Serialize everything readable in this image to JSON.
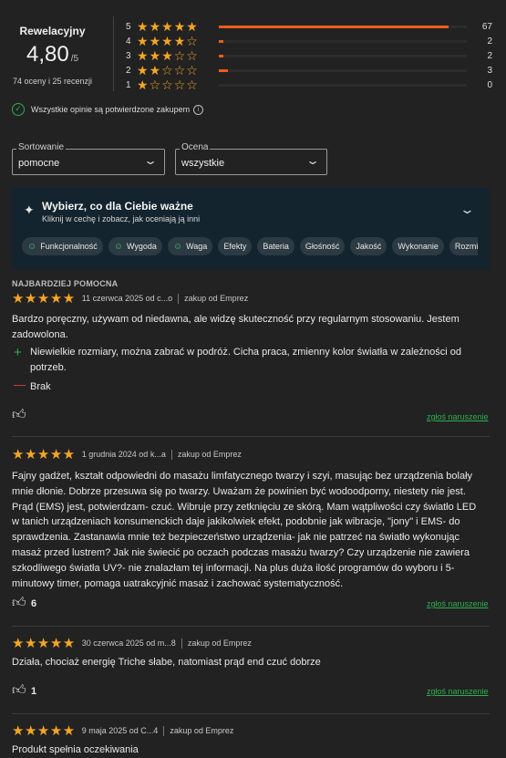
{
  "summary": {
    "label": "Rewelacyjny",
    "rating": "4,80",
    "rating_of": "/5",
    "counts_text": "74 oceny i 25 recenzji",
    "verified_text": "Wszystkie opinie są potwierdzone zakupem",
    "distribution": [
      {
        "stars": "5",
        "count": "67",
        "share": 0.926
      },
      {
        "stars": "4",
        "count": "2",
        "share": 0.015
      },
      {
        "stars": "3",
        "count": "2",
        "share": 0.015
      },
      {
        "stars": "2",
        "count": "3",
        "share": 0.035
      },
      {
        "stars": "1",
        "count": "0",
        "share": 0.0
      }
    ]
  },
  "filters": {
    "sort_label": "Sortowanie",
    "sort_value": "pomocne",
    "rating_label": "Ocena",
    "rating_value": "wszystkie"
  },
  "highlights": {
    "title": "Wybierz, co dla Ciebie ważne",
    "subtitle": "Kliknij w cechę i zobacz, jak oceniają ją inni",
    "chips": [
      {
        "label": "Funkcjonalność",
        "smiley": true
      },
      {
        "label": "Wygoda",
        "smiley": true
      },
      {
        "label": "Waga",
        "smiley": true
      },
      {
        "label": "Efekty",
        "smiley": false
      },
      {
        "label": "Bateria",
        "smiley": false
      },
      {
        "label": "Głośność",
        "smiley": false
      },
      {
        "label": "Jakość",
        "smiley": false
      },
      {
        "label": "Wykonanie",
        "smiley": false
      },
      {
        "label": "Rozmiar",
        "smiley": false
      }
    ]
  },
  "most_helpful_label": "NAJBARDZIEJ POMOCNA",
  "reviews": [
    {
      "rating": 5,
      "date": "11 czerwca 2025 od c...o",
      "source": "zakup od Emprez",
      "text": "Bardzo poręczny, używam od niedawna, ale widzę skuteczność przy regularnym stosowaniu. Jestem zadowolona.",
      "pros": "Niewielkie rozmiary, można zabrać w podróż. Cicha praca, zmienny kolor światła w zależności od potrzeb.",
      "cons": "Brak",
      "likes": "",
      "report": "zgłoś naruszenie"
    },
    {
      "rating": 5,
      "date": "1 grudnia 2024 od k...a",
      "source": "zakup od Emprez",
      "text": "Fajny gadżet, kształt odpowiedni do masażu limfatycznego twarzy i szyi, masując bez urządzenia bolały mnie dłonie. Dobrze przesuwa się po twarzy. Uważam że powinien być wodoodporny, niestety nie jest. Prąd (EMS) jest, potwierdzam- czuć. Wibruje przy zetknięciu ze skórą. Mam wątpliwości czy światło LED w tanich urządzeniach konsumenckich daje jakikolwiek efekt, podobnie jak wibracje, \"jony\" i EMS- do sprawdzenia. Zastanawia mnie też bezpieczeństwo urządzenia- jak nie patrzeć na światło wykonując masaż przed lustrem? Jak nie świecić po oczach podczas masażu twarzy? Czy urządzenie nie zawiera szkodliwego światła UV?- nie znalazłam tej informacji. Na plus duża ilość programów do wyboru i 5-minutowy timer, pomaga uatrakcyjnić masaż i zachować systematyczność.",
      "likes": "6",
      "report": "zgłoś naruszenie"
    },
    {
      "rating": 5,
      "date": "30 czerwca 2025 od m...8",
      "source": "zakup od Emprez",
      "text": "Działa, chociaż energię Triche słabe, natomiast prąd end czuć dobrze",
      "likes": "1",
      "report": "zgłoś naruszenie"
    },
    {
      "rating": 5,
      "date": "9 maja 2025 od C...4",
      "source": "zakup od Emprez",
      "text": "Produkt spełnia oczekiwania"
    }
  ]
}
